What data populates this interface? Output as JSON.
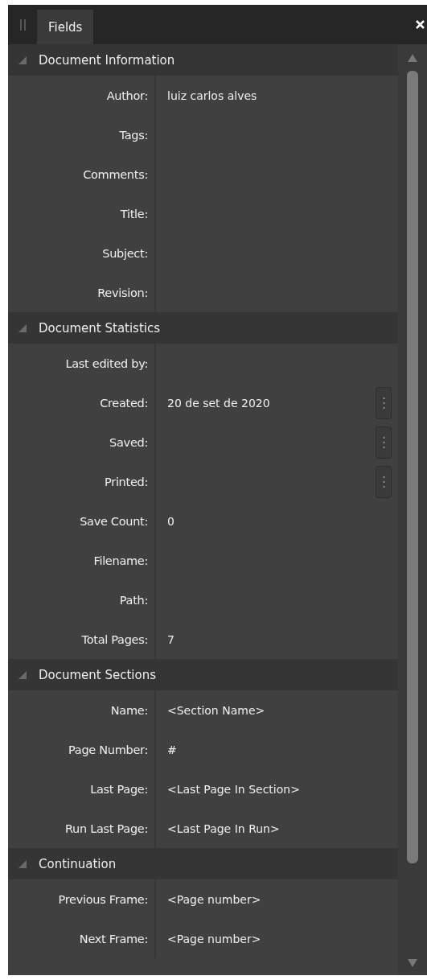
{
  "tab": {
    "label": "Fields",
    "selected": true
  },
  "sections": [
    {
      "title": "Document Information",
      "expanded": true,
      "fields": [
        {
          "label": "Author:",
          "value": "luiz carlos alves",
          "has_menu": false
        },
        {
          "label": "Tags:",
          "has_menu": false
        },
        {
          "label": "Comments:",
          "has_menu": false
        },
        {
          "label": "Title:",
          "has_menu": false
        },
        {
          "label": "Subject:",
          "has_menu": false
        },
        {
          "label": "Revision:",
          "has_menu": false
        }
      ]
    },
    {
      "title": "Document Statistics",
      "expanded": true,
      "fields": [
        {
          "label": "Last edited by:",
          "has_menu": false
        },
        {
          "label": "Created:",
          "value": "20 de set de 2020",
          "has_menu": true
        },
        {
          "label": "Saved:",
          "has_menu": true
        },
        {
          "label": "Printed:",
          "has_menu": true
        },
        {
          "label": "Save Count:",
          "value": "0",
          "has_menu": false
        },
        {
          "label": "Filename:",
          "has_menu": false
        },
        {
          "label": "Path:",
          "has_menu": false
        },
        {
          "label": "Total Pages:",
          "value": "7",
          "has_menu": false
        }
      ]
    },
    {
      "title": "Document Sections",
      "expanded": true,
      "fields": [
        {
          "label": "Name:",
          "value": "<Section Name>",
          "has_menu": false
        },
        {
          "label": "Page Number:",
          "value": "#",
          "has_menu": false
        },
        {
          "label": "Last Page:",
          "value": "<Last Page In Section>",
          "has_menu": false
        },
        {
          "label": "Run Last Page:",
          "value": "<Last Page In Run>",
          "has_menu": false
        }
      ]
    },
    {
      "title": "Continuation",
      "expanded": true,
      "fields": [
        {
          "label": "Previous Frame:",
          "value": "<Page number>",
          "has_menu": false
        },
        {
          "label": "Next Frame:",
          "value": "<Page number>",
          "has_menu": false
        }
      ]
    }
  ]
}
